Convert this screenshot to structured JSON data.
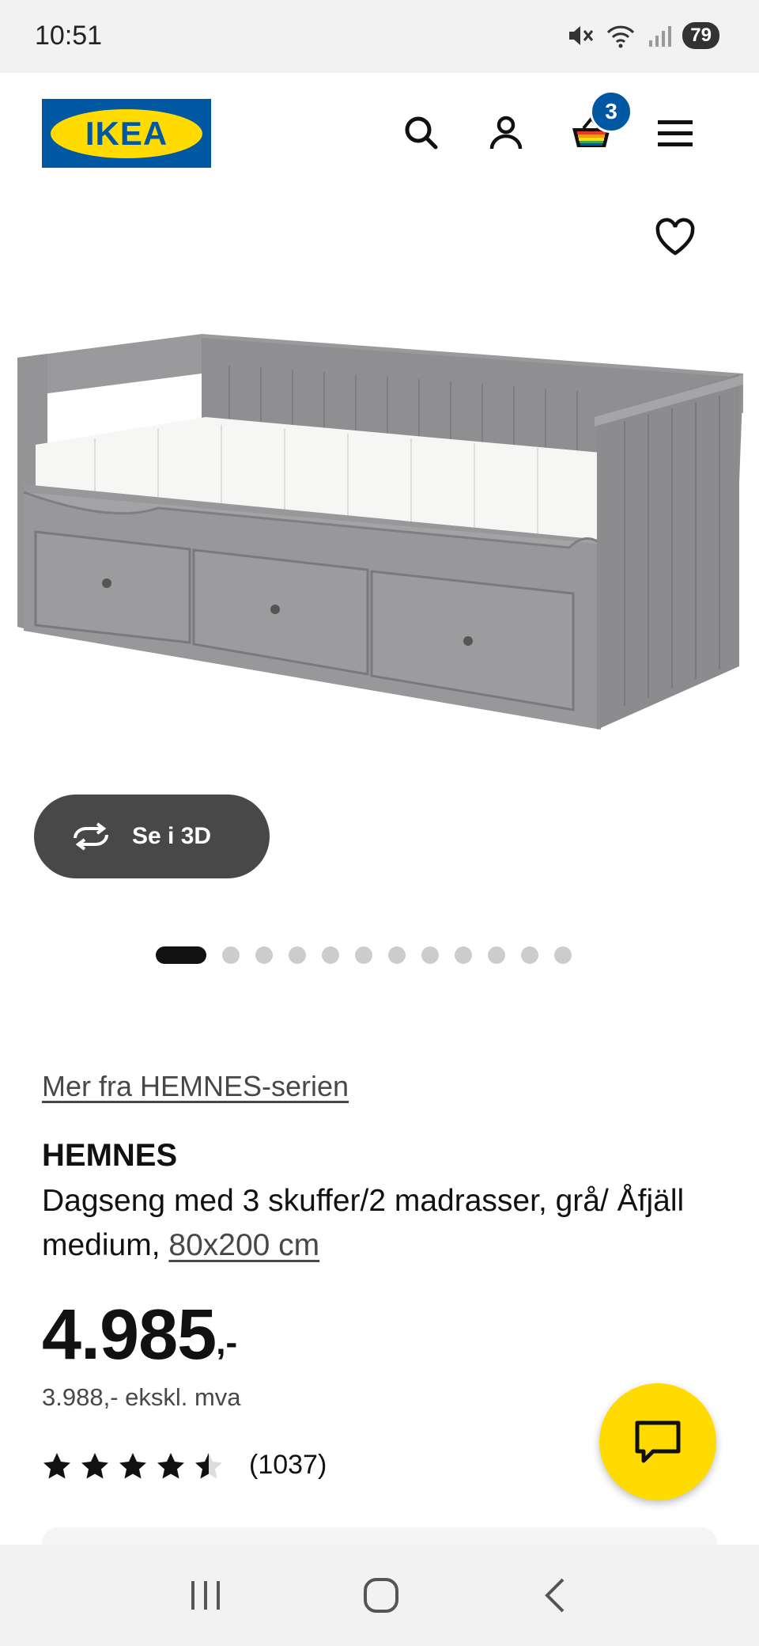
{
  "status_bar": {
    "time": "10:51",
    "battery": "79"
  },
  "header": {
    "cart_count": "3"
  },
  "gallery": {
    "see_3d_label": "Se i 3D",
    "dot_count": 12,
    "active_dot": 0
  },
  "product": {
    "series_link": "Mer fra HEMNES-serien",
    "name": "HEMNES",
    "description_main": "Dagseng med 3 skuffer/2 madrasser, grå/ Åfjäll medium, ",
    "size_link": "80x200 cm",
    "price_amount": "4.985",
    "price_suffix": ",-",
    "price_ex_vat": "3.988,- ekskl. mva",
    "rating": {
      "stars": 4.5,
      "max": 5,
      "count": "(1037)"
    }
  },
  "colors": {
    "ikea_blue": "#0058a3",
    "ikea_yellow": "#ffdb00",
    "frame_grey": "#8f8f92"
  }
}
